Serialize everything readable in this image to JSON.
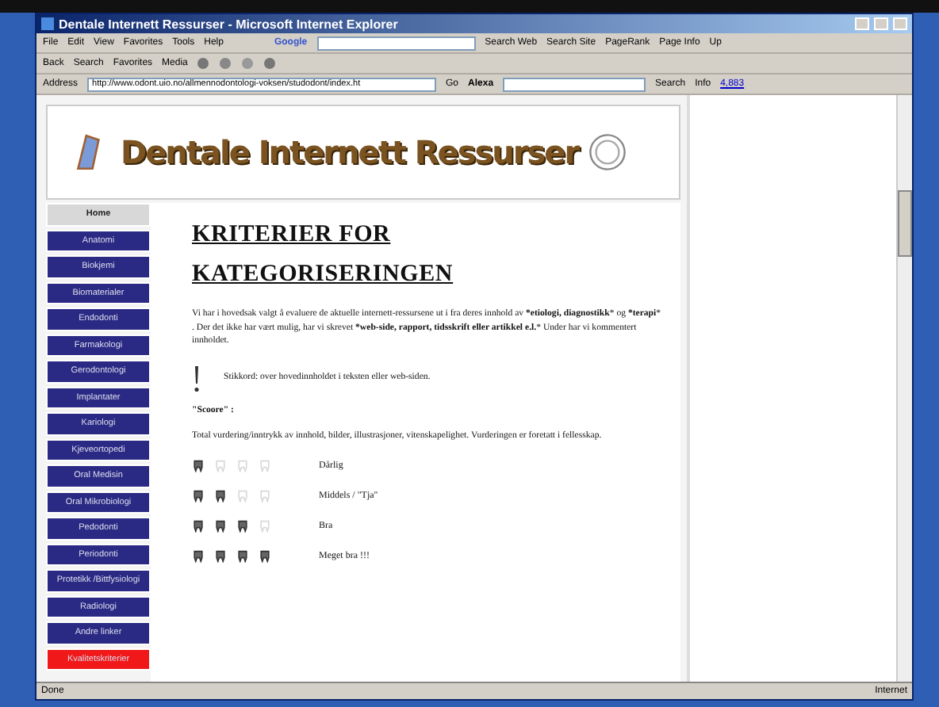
{
  "window": {
    "title": "Dentale Internett Ressurser - Microsoft Internet Explorer"
  },
  "menu": [
    "File",
    "Edit",
    "View",
    "Favorites",
    "Tools",
    "Help"
  ],
  "google_toolbar": {
    "logo": "Google",
    "buttons": [
      "Search Web",
      "Search Site",
      "PageRank",
      "Page Info",
      "Up"
    ]
  },
  "toolbar": [
    "Back",
    "Search",
    "Favorites",
    "Media"
  ],
  "address_bar": {
    "label": "Address",
    "value": "http://www.odont.uio.no/allmennodontologi-voksen/studodont/index.ht",
    "go": "Go",
    "alexa": "Alexa",
    "search": "Search",
    "info": "Info",
    "count": "4,883"
  },
  "banner": {
    "title": "Dentale Internett Ressurser"
  },
  "sidebar": {
    "items": [
      {
        "label": "Home",
        "kind": "home"
      },
      {
        "label": "Anatomi",
        "kind": "link"
      },
      {
        "label": "Biokjemi",
        "kind": "link"
      },
      {
        "label": "Biomaterialer",
        "kind": "link"
      },
      {
        "label": "Endodonti",
        "kind": "link"
      },
      {
        "label": "Farmakologi",
        "kind": "link"
      },
      {
        "label": "Gerodontologi",
        "kind": "link"
      },
      {
        "label": "Implantater",
        "kind": "link"
      },
      {
        "label": "Kariologi",
        "kind": "link"
      },
      {
        "label": "Kjeveortopedi",
        "kind": "link"
      },
      {
        "label": "Oral Medisin",
        "kind": "link"
      },
      {
        "label": "Oral Mikrobiologi",
        "kind": "link"
      },
      {
        "label": "Pedodonti",
        "kind": "link"
      },
      {
        "label": "Periodonti",
        "kind": "link"
      },
      {
        "label": "Protetikk /Bittfysiologi",
        "kind": "link"
      },
      {
        "label": "Radiologi",
        "kind": "link"
      },
      {
        "label": "Andre linker",
        "kind": "link"
      },
      {
        "label": "Kvalitetskriterier",
        "kind": "current"
      }
    ]
  },
  "content": {
    "heading": [
      "KRITERIER FOR",
      "KATEGORISERINGEN"
    ],
    "intro": "Vi har i hovedsak valgt å evaluere de aktuelle internett-ressursene ut i fra deres innhold av ***etiologi, diagnostikk*** og ***terapi*** . Der det ikke har vært mulig, har vi skrevet ***web-side, rapport, tidsskrift eller artikkel e.l.*** Under har vi kommentert innholdet.",
    "note": "Stikkord: over hovedinnholdet i teksten eller web-siden.",
    "score_label": "\"Scoore\" :",
    "score_text": "Total vurdering/inntrykk av innhold, bilder, illustrasjoner, vitenskapelighet. Vurderingen er foretatt i fellesskap.",
    "ratings": [
      {
        "stars": 1,
        "label": "Dårlig"
      },
      {
        "stars": 2,
        "label": "Middels / \"Tja\""
      },
      {
        "stars": 3,
        "label": "Bra"
      },
      {
        "stars": 4,
        "label": "Meget bra !!!"
      }
    ]
  },
  "status_bar": {
    "text": "Done",
    "zone": "Internet"
  }
}
